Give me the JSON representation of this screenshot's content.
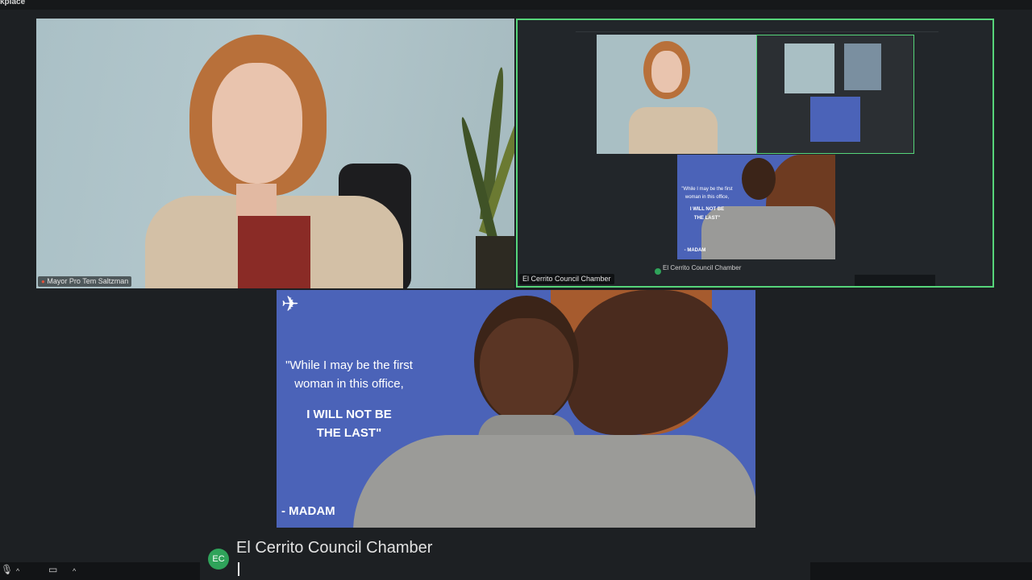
{
  "app": {
    "title_fragment": "kplace"
  },
  "tiles": {
    "saltzman": {
      "name": "Mayor Pro Tem Saltzman"
    },
    "share": {
      "label": "El Cerrito Council Chamber",
      "inner_label": "El Cerrito Council Chamber"
    },
    "bottom": {
      "quote_line1": "\"While I may be the first",
      "quote_line2": "woman in this office,",
      "quote_line3": "I WILL NOT BE",
      "quote_line4": "THE LAST\"",
      "attribution": "- MADAM"
    }
  },
  "share_inner": {
    "quote_line1": "\"While I may be the first",
    "quote_line2": "woman in this office,",
    "quote_line3": "I WILL NOT BE",
    "quote_line4": "THE LAST\"",
    "attribution": "- MADAM"
  },
  "participant": {
    "initials": "EC",
    "name": "El Cerrito Council Chamber"
  },
  "colors": {
    "active_speaker_border": "#56d57a",
    "avatar": "#2fa35a",
    "quote_bg": "#4b63b8"
  },
  "icons": [
    "mic-icon",
    "chevron-up-icon",
    "video-camera-icon",
    "hummingbird-logo"
  ]
}
